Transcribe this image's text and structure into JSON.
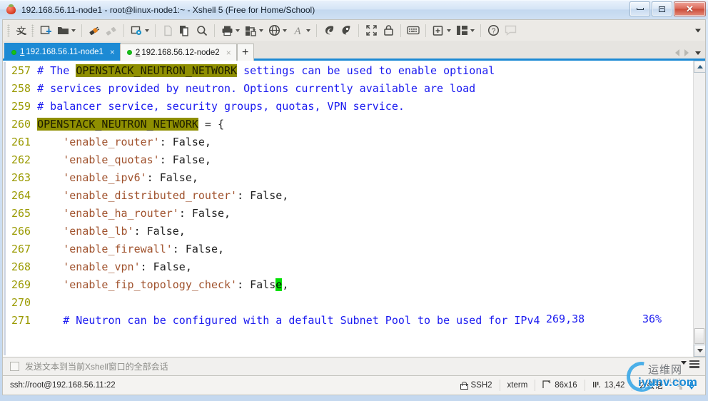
{
  "window": {
    "title": "192.168.56.11-node1 - root@linux-node1:~ - Xshell 5 (Free for Home/School)",
    "minimize_label": "Minimize",
    "maximize_label": "Maximize",
    "close_label": "✕"
  },
  "toolbar": {
    "items": [
      {
        "name": "chinese-input-icon",
        "label": "文"
      },
      {
        "name": "new-session-icon",
        "label": "New Session"
      },
      {
        "name": "open-folder-icon",
        "label": "Open"
      },
      {
        "name": "connect-icon",
        "label": "Connect"
      },
      {
        "name": "disconnect-icon",
        "label": "Disconnect"
      },
      {
        "name": "session-properties-icon",
        "label": "Properties"
      },
      {
        "name": "cut-icon",
        "label": "Cut"
      },
      {
        "name": "copy-paste-icon",
        "label": "Copy and Paste"
      },
      {
        "name": "find-icon",
        "label": "Find"
      },
      {
        "name": "print-icon",
        "label": "Print"
      },
      {
        "name": "file-transfer-icon",
        "label": "File Transfer"
      },
      {
        "name": "globe-icon",
        "label": "Tunneling"
      },
      {
        "name": "font-icon",
        "label": "Font"
      },
      {
        "name": "xftp-icon",
        "label": "Xftp"
      },
      {
        "name": "xagent-icon",
        "label": "Xagent"
      },
      {
        "name": "fullscreen-icon",
        "label": "Full Screen"
      },
      {
        "name": "lock-icon",
        "label": "Lock"
      },
      {
        "name": "keyboard-icon",
        "label": "Compose Bar"
      },
      {
        "name": "new-window-icon",
        "label": "New Window"
      },
      {
        "name": "layout-icon",
        "label": "Arrange Layout"
      },
      {
        "name": "help-icon",
        "label": "Help"
      },
      {
        "name": "comment-icon",
        "label": "Feedback"
      }
    ],
    "overflow_label": "More toolbar buttons"
  },
  "tabs": {
    "items": [
      {
        "num": "1",
        "title": "192.168.56.11-node1",
        "active": true,
        "status": "connected",
        "close": "×"
      },
      {
        "num": "2",
        "title": "192.168.56.12-node2",
        "active": false,
        "status": "connected",
        "close": "×"
      }
    ],
    "new_tab_label": "+",
    "nav_prev_label": "Previous tab",
    "nav_next_label": "Next tab",
    "nav_list_label": "Tab list"
  },
  "terminal": {
    "lines": [
      {
        "num": "257",
        "segments": [
          {
            "text": "# The ",
            "style": "cm"
          },
          {
            "text": "OPENSTACK_NEUTRON_NETWORK",
            "style": "hl"
          },
          {
            "text": " settings can be used to enable optional",
            "style": "cm"
          }
        ]
      },
      {
        "num": "258",
        "segments": [
          {
            "text": "# services provided by neutron. Options currently available are load",
            "style": "cm"
          }
        ]
      },
      {
        "num": "259",
        "segments": [
          {
            "text": "# balancer service, security groups, quotas, VPN service.",
            "style": "cm"
          }
        ]
      },
      {
        "num": "260",
        "segments": [
          {
            "text": "OPENSTACK_NEUTRON_NETWORK",
            "style": "hl"
          },
          {
            "text": " = {",
            "style": "pl"
          }
        ]
      },
      {
        "num": "261",
        "segments": [
          {
            "text": "    'enable_router'",
            "style": "str"
          },
          {
            "text": ": False,",
            "style": "pl"
          }
        ]
      },
      {
        "num": "262",
        "segments": [
          {
            "text": "    'enable_quotas'",
            "style": "str"
          },
          {
            "text": ": False,",
            "style": "pl"
          }
        ]
      },
      {
        "num": "263",
        "segments": [
          {
            "text": "    'enable_ipv6'",
            "style": "str"
          },
          {
            "text": ": False,",
            "style": "pl"
          }
        ]
      },
      {
        "num": "264",
        "segments": [
          {
            "text": "    'enable_distributed_router'",
            "style": "str"
          },
          {
            "text": ": False,",
            "style": "pl"
          }
        ]
      },
      {
        "num": "265",
        "segments": [
          {
            "text": "    'enable_ha_router'",
            "style": "str"
          },
          {
            "text": ": False,",
            "style": "pl"
          }
        ]
      },
      {
        "num": "266",
        "segments": [
          {
            "text": "    'enable_lb'",
            "style": "str"
          },
          {
            "text": ": False,",
            "style": "pl"
          }
        ]
      },
      {
        "num": "267",
        "segments": [
          {
            "text": "    'enable_firewall'",
            "style": "str"
          },
          {
            "text": ": False,",
            "style": "pl"
          }
        ]
      },
      {
        "num": "268",
        "segments": [
          {
            "text": "    'enable_vpn'",
            "style": "str"
          },
          {
            "text": ": False,",
            "style": "pl"
          }
        ]
      },
      {
        "num": "269",
        "segments": [
          {
            "text": "    'enable_fip_topology_check'",
            "style": "str"
          },
          {
            "text": ": Fals",
            "style": "pl"
          },
          {
            "text": "e",
            "style": "cursor"
          },
          {
            "text": ",",
            "style": "pl"
          }
        ]
      },
      {
        "num": "270",
        "segments": []
      },
      {
        "num": "271",
        "segments": [
          {
            "text": "    # Neutron can be configured with a default Subnet Pool to be used for IPv4",
            "style": "cm"
          }
        ]
      }
    ],
    "status_position": "269,38",
    "status_percent": "36%"
  },
  "scrollbar": {
    "up_label": "Scroll up",
    "down_label": "Scroll down",
    "thumb_label": "Scroll thumb"
  },
  "compose_bar": {
    "checkbox_checked": false,
    "label": "发送文本到当前Xshell窗口的全部会话"
  },
  "statusbar": {
    "url": "ssh://root@192.168.56.11:22",
    "protocol": "SSH2",
    "terminal_type": "xterm",
    "size": "86x16",
    "cursor": "13,42",
    "sessions": "2 会话",
    "upload_label": "Upload",
    "download_label": "Download"
  },
  "watermark": {
    "chinese": "运维网",
    "english": "iyunv.com",
    "caps": "CAP NUM"
  }
}
